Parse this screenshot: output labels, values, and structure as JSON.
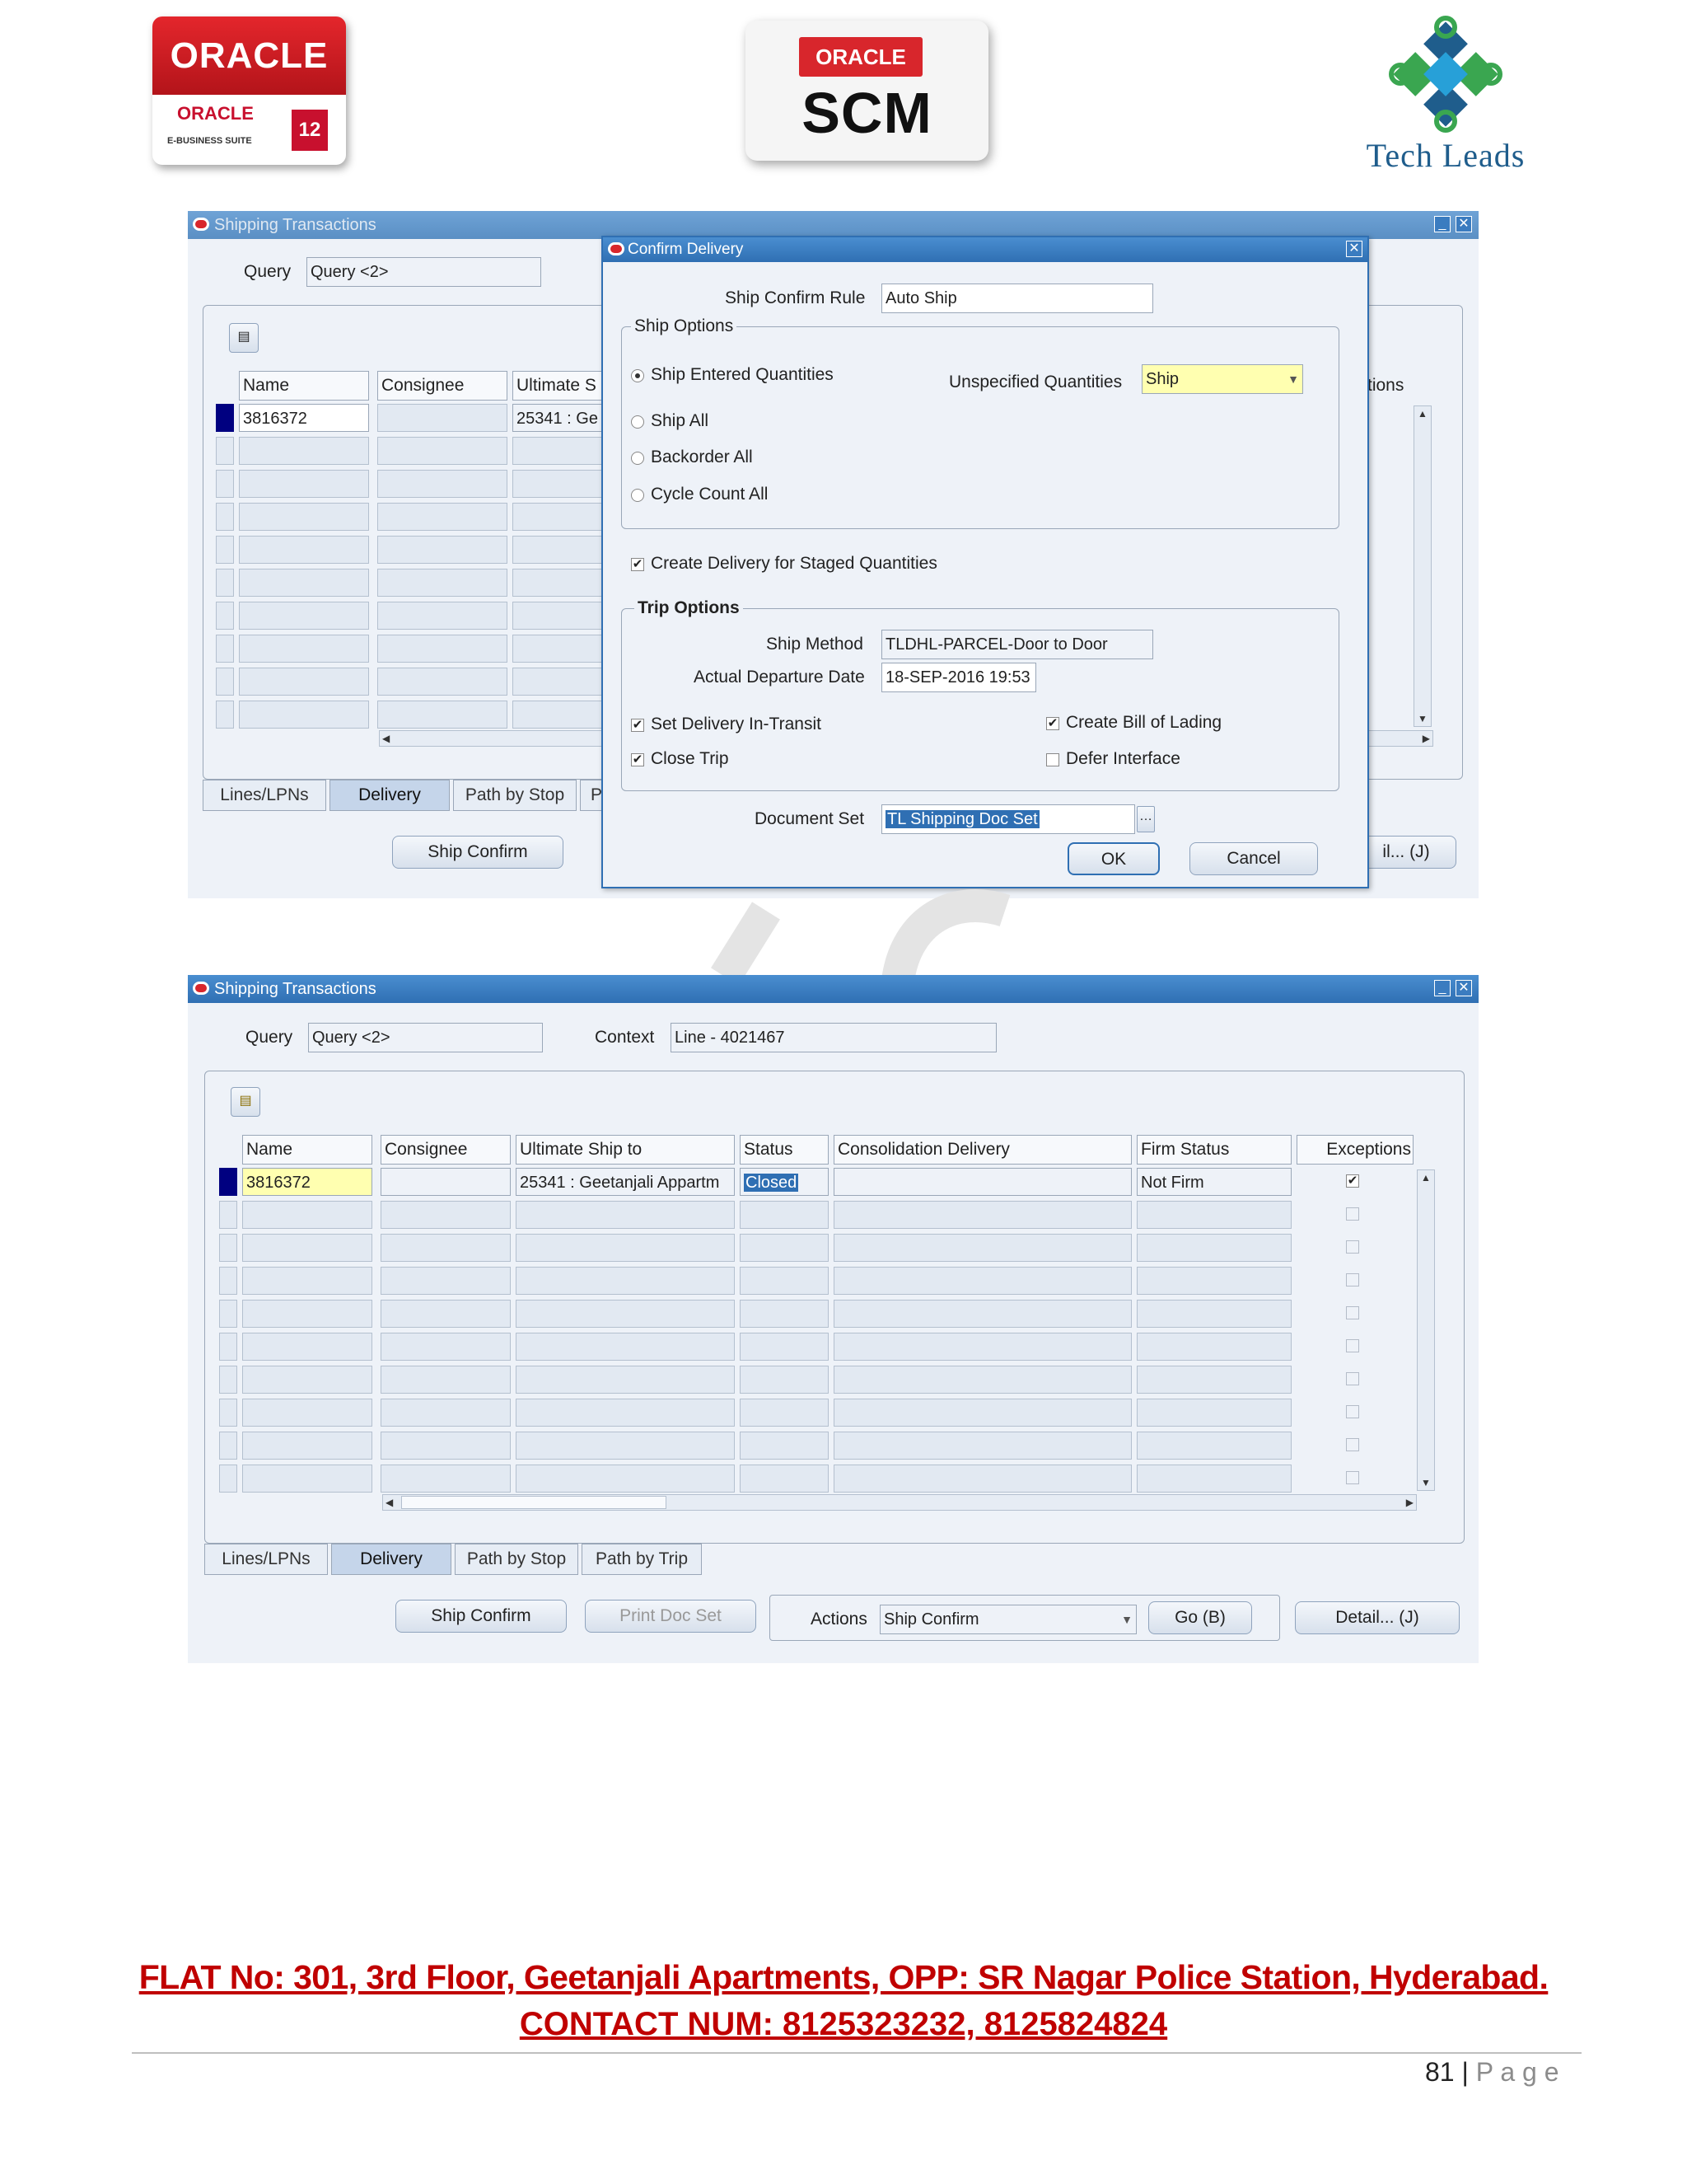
{
  "logos": {
    "oracle_ebs": {
      "top": "ORACLE",
      "small": "ORACLE",
      "sub": "E-BUSINESS SUITE",
      "release": "12"
    },
    "oracle_scm": {
      "brand": "ORACLE",
      "product": "SCM"
    },
    "techleads": {
      "name": "Tech Leads"
    }
  },
  "screen1": {
    "window_title": "Shipping Transactions",
    "query_label": "Query",
    "query_value": "Query <2>",
    "columns": [
      "Name",
      "Consignee",
      "Ultimate S"
    ],
    "row1": {
      "name": "3816372",
      "ultimate": "25341 : Ge"
    },
    "exceptions_partial": "tions",
    "tabs": [
      "Lines/LPNs",
      "Delivery",
      "Path by Stop",
      "P"
    ],
    "ship_confirm_button": "Ship Confirm",
    "detail_partial": "il... (J)",
    "dialog": {
      "title": "Confirm Delivery",
      "ship_confirm_rule_label": "Ship Confirm Rule",
      "ship_confirm_rule_value": "Auto Ship",
      "ship_options_label": "Ship Options",
      "opt_entered": "Ship Entered Quantities",
      "unspecified_label": "Unspecified Quantities",
      "unspecified_value": "Ship",
      "opt_all": "Ship All",
      "opt_backorder": "Backorder All",
      "opt_cycle": "Cycle Count All",
      "create_delivery_staged": "Create Delivery for Staged Quantities",
      "trip_options_label": "Trip Options",
      "ship_method_label": "Ship Method",
      "ship_method_value": "TLDHL-PARCEL-Door to Door",
      "departure_label": "Actual Departure Date",
      "departure_value": "18-SEP-2016 19:53",
      "set_in_transit": "Set Delivery In-Transit",
      "create_bol": "Create Bill of Lading",
      "close_trip": "Close Trip",
      "defer_interface": "Defer Interface",
      "document_set_label": "Document Set",
      "document_set_value": "TL Shipping Doc Set",
      "ok": "OK",
      "cancel": "Cancel"
    }
  },
  "screen2": {
    "window_title": "Shipping Transactions",
    "query_label": "Query",
    "query_value": "Query <2>",
    "context_label": "Context",
    "context_value": "Line - 4021467",
    "columns": [
      "Name",
      "Consignee",
      "Ultimate Ship to",
      "Status",
      "Consolidation Delivery",
      "Firm Status",
      "Exceptions"
    ],
    "row1": {
      "name": "3816372",
      "consignee": "",
      "ultimate": "25341 : Geetanjali Appartm",
      "status": "Closed",
      "consolidation": "",
      "firm": "Not Firm"
    },
    "tabs": [
      "Lines/LPNs",
      "Delivery",
      "Path by Stop",
      "Path by Trip"
    ],
    "ship_confirm_button": "Ship Confirm",
    "print_doc_set_button": "Print Doc Set",
    "actions_label": "Actions",
    "actions_value": "Ship Confirm",
    "go_button": "Go (B)",
    "detail_button": "Detail... (J)"
  },
  "footer": {
    "address": "FLAT No: 301, 3rd Floor, Geetanjali Apartments, OPP: SR Nagar Police Station, Hyderabad.",
    "contact": "CONTACT NUM: 8125323232, 8125824824",
    "page_number": "81",
    "page_word": "P a g e"
  },
  "colors": {
    "title_bar": "#2f6fb3",
    "current_record": "#000080",
    "address_red": "#c00000",
    "required_yellow": "#ffffb0"
  }
}
